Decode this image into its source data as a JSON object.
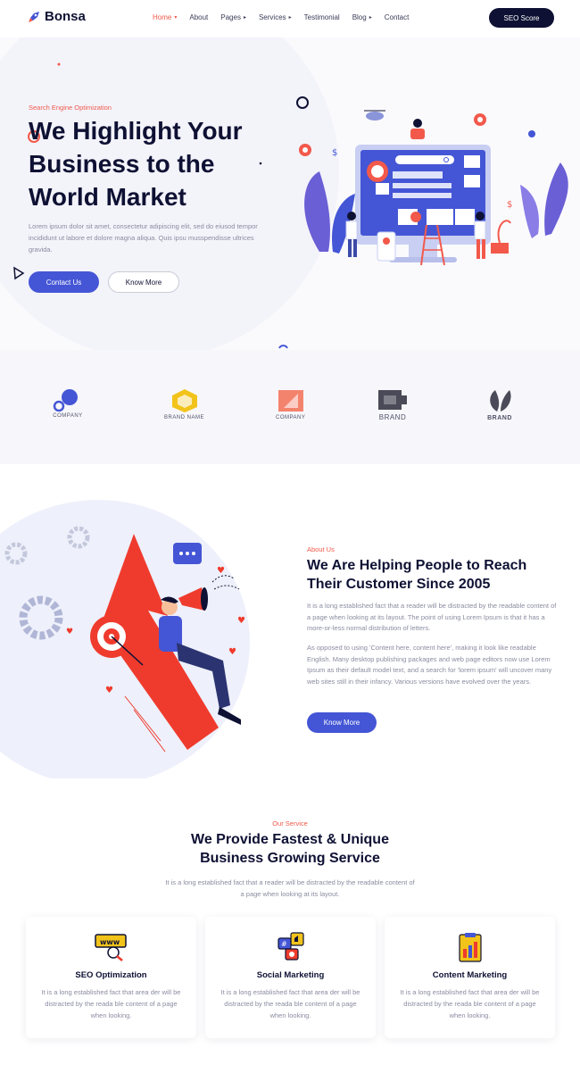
{
  "nav": {
    "logo_text": "Bonsa",
    "items": [
      {
        "label": "Home",
        "active": true,
        "chevron": "chevron-down"
      },
      {
        "label": "About",
        "active": false,
        "chevron": ""
      },
      {
        "label": "Pages",
        "active": false,
        "chevron": "chevron-right"
      },
      {
        "label": "Services",
        "active": false,
        "chevron": "chevron-right"
      },
      {
        "label": "Testimonial",
        "active": false,
        "chevron": ""
      },
      {
        "label": "Blog",
        "active": false,
        "chevron": "chevron-right"
      },
      {
        "label": "Contact",
        "active": false,
        "chevron": ""
      }
    ],
    "cta_label": "SEO Score"
  },
  "hero": {
    "eyebrow": "Search Engine Optimization",
    "title_line1": "We Highlight Your",
    "title_line2": "Business to the",
    "title_line3": "World Market",
    "description": "Lorem ipsum dolor sit amet, consectetur adipiscing elit, sed do eiusod tempor incididunt ut labore et dolore magna aliqua. Quis ipsu musspendisse ultrices gravida.",
    "primary_button": "Contact Us",
    "secondary_button": "Know More"
  },
  "brands": {
    "items": [
      {
        "name": "COMPANY",
        "icon": "drop-logo-icon"
      },
      {
        "name": "BRAND NAME",
        "icon": "hexagon-logo-icon"
      },
      {
        "name": "COMPANY",
        "icon": "square-logo-icon"
      },
      {
        "name": "BRAND",
        "icon": "block-logo-icon"
      },
      {
        "name": "BRAND",
        "icon": "leaf-logo-icon"
      }
    ]
  },
  "about": {
    "eyebrow": "About Us",
    "title_line1": "We Are Helping People to Reach",
    "title_line2": "Their Customer Since 2005",
    "paragraph1": "It is a long established fact that a reader will be distracted by the readable content of a page when looking at its layout. The point of using Lorem Ipsum is that it has a more-or-less normal distribution of letters.",
    "paragraph2": "As opposed to using 'Content here, content here', making it look like readable English. Many desktop publishing packages and web page editors now use Lorem Ipsum as their default model text, and a search for 'lorem ipsum' will uncover many web sites still in their infancy. Various versions have evolved over the years.",
    "button": "Know More"
  },
  "services": {
    "eyebrow": "Our Service",
    "title_line1": "We Provide Fastest & Unique",
    "title_line2": "Business Growing Service",
    "description": "It is a long established fact that a reader will be distracted by the readable content of a page when looking at its layout.",
    "cards": [
      {
        "title": "SEO Optimization",
        "text": "It is a long established fact that area der will be distracted by the reada ble content of a page when looking.",
        "icon": "www-search-icon"
      },
      {
        "title": "Social Marketing",
        "text": "It is a long established fact that area der will be distracted by the reada ble content of a page when looking.",
        "icon": "social-icon"
      },
      {
        "title": "Content Marketing",
        "text": "It is a long established fact that area der will be distracted by the reada ble content of a page when looking.",
        "icon": "clipboard-chart-icon"
      }
    ]
  },
  "colors": {
    "primary": "#4456d5",
    "accent": "#f2594b",
    "dark": "#0e1133"
  }
}
